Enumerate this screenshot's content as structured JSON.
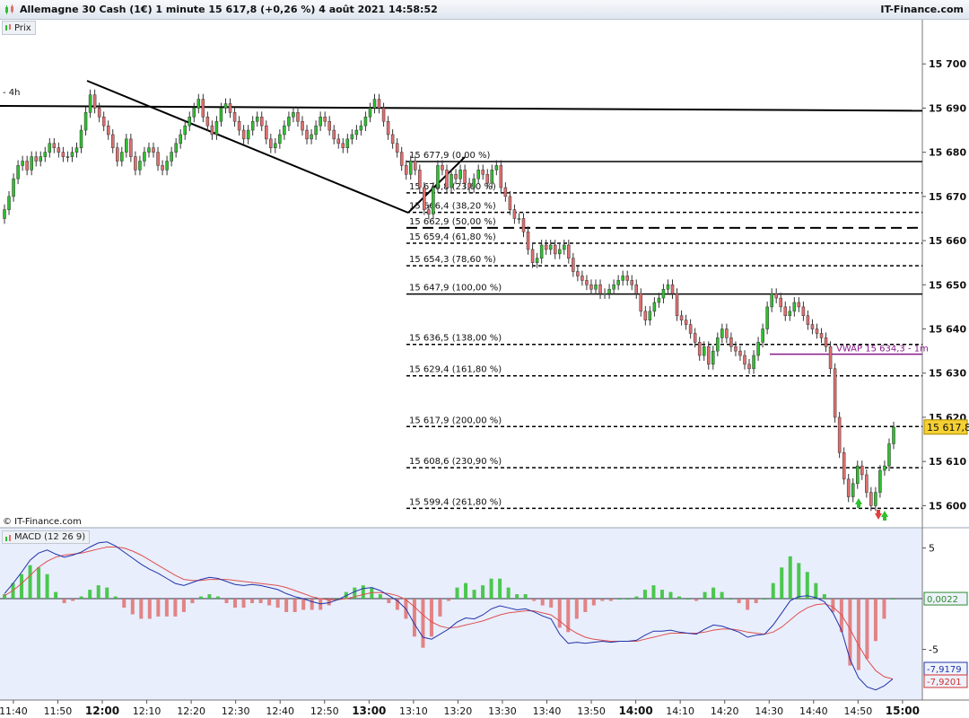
{
  "header": {
    "title": "Allemagne 30 Cash (1€) 1 minute 15 617,8 (+0,26 %) 4 août 2021 14:58:52",
    "brand": "IT-Finance.com"
  },
  "panels": {
    "price_tab": "Prix",
    "macd_tab": "MACD (12 26 9)",
    "copyright": "© IT-Finance.com",
    "timeframe_label": "- 4h"
  },
  "colors": {
    "up": "#2fbf2f",
    "down": "#e07070",
    "macd_line": "#2233aa",
    "signal_line": "#e05050",
    "vwap": "#8a1a8a",
    "price_badge": "#f5d033",
    "macd_bg": "#e8eefc"
  },
  "chart_data": [
    {
      "type": "candlestick",
      "title": "Allemagne 30 Cash (1€) 1 minute",
      "x_ticks": [
        "11:40",
        "11:50",
        "12:00",
        "12:10",
        "12:20",
        "12:30",
        "12:40",
        "12:50",
        "13:00",
        "13:10",
        "13:20",
        "13:30",
        "13:40",
        "13:50",
        "14:00",
        "14:10",
        "14:20",
        "14:30",
        "14:40",
        "14:50",
        "15:00"
      ],
      "bold_ticks": [
        "12:00",
        "13:00",
        "14:00",
        "15:00"
      ],
      "y_ticks": [
        "15 600",
        "15 610",
        "15 620",
        "15 630",
        "15 640",
        "15 650",
        "15 660",
        "15 670",
        "15 680",
        "15 690",
        "15 700"
      ],
      "ylim": [
        15595,
        15710
      ],
      "last_price": "15 617,8",
      "last_value": 15617.8,
      "fibonacci_levels": [
        {
          "label": "15 677,9 (0,00 %)",
          "value": 15677.9,
          "style": "solid"
        },
        {
          "label": "15 670,8 (23,60 %)",
          "value": 15670.8,
          "style": "dotted"
        },
        {
          "label": "15 666,4 (38,20 %)",
          "value": 15666.4,
          "style": "dotted"
        },
        {
          "label": "15 662,9 (50,00 %)",
          "value": 15662.9,
          "style": "dashed"
        },
        {
          "label": "15 659,4 (61,80 %)",
          "value": 15659.4,
          "style": "dotted"
        },
        {
          "label": "15 654,3 (78,60 %)",
          "value": 15654.3,
          "style": "dotted"
        },
        {
          "label": "15 647,9 (100,00 %)",
          "value": 15647.9,
          "style": "solid"
        },
        {
          "label": "15 636,5 (138,00 %)",
          "value": 15636.5,
          "style": "dotted"
        },
        {
          "label": "15 629,4 (161,80 %)",
          "value": 15629.4,
          "style": "dotted"
        },
        {
          "label": "15 617,9 (200,00 %)",
          "value": 15617.9,
          "style": "dotted"
        },
        {
          "label": "15 608,6 (230,90 %)",
          "value": 15608.6,
          "style": "dotted"
        },
        {
          "label": "15 599,4 (261,80 %)",
          "value": 15599.4,
          "style": "dotted"
        }
      ],
      "vwap": {
        "label": "VWAP 15 634,3 - 1m",
        "value": 15634.3
      },
      "close_prices": [
        15667,
        15670,
        15674,
        15677,
        15678,
        15676,
        15679,
        15678,
        15679,
        15680,
        15682,
        15681,
        15680,
        15679,
        15679,
        15680,
        15681,
        15685,
        15689,
        15693,
        15690,
        15688,
        15686,
        15684,
        15681,
        15678,
        15680,
        15683,
        15679,
        15676,
        15678,
        15680,
        15681,
        15680,
        15677,
        15676,
        15678,
        15680,
        15682,
        15684,
        15686,
        15688,
        15690,
        15692,
        15688,
        15686,
        15684,
        15687,
        15690,
        15691,
        15689,
        15687,
        15685,
        15683,
        15685,
        15687,
        15688,
        15686,
        15683,
        15681,
        15682,
        15684,
        15686,
        15688,
        15689,
        15687,
        15685,
        15683,
        15684,
        15686,
        15688,
        15687,
        15685,
        15683,
        15682,
        15681,
        15683,
        15684,
        15685,
        15686,
        15688,
        15690,
        15692,
        15690,
        15687,
        15684,
        15682,
        15680,
        15677,
        15675,
        15678,
        15676,
        15672,
        15667,
        15666,
        15672,
        15677,
        15676,
        15672,
        15675,
        15674,
        15676,
        15673,
        15672,
        15674,
        15676,
        15675,
        15673,
        15676,
        15677,
        15672,
        15670,
        15667,
        15665,
        15665,
        15662,
        15658,
        15655,
        15656,
        15659,
        15658,
        15659,
        15657,
        15658,
        15659,
        15656,
        15653,
        15652,
        15651,
        15650,
        15649,
        15650,
        15648,
        15648,
        15649,
        15650,
        15651,
        15652,
        15651,
        15650,
        15648,
        15644,
        15642,
        15644,
        15646,
        15647,
        15649,
        15650,
        15648,
        15643,
        15642,
        15641,
        15639,
        15637,
        15634,
        15636,
        15632,
        15635,
        15638,
        15640,
        15638,
        15636,
        15635,
        15634,
        15632,
        15631,
        15634,
        15637,
        15640,
        15645,
        15648,
        15647,
        15645,
        15643,
        15644,
        15646,
        15645,
        15643,
        15641,
        15640,
        15639,
        15638,
        15636,
        15631,
        15620,
        15612,
        15606,
        15602,
        15605,
        15609,
        15607,
        15603,
        15600,
        15603,
        15608,
        15609,
        15614,
        15617.8
      ],
      "open_prices": [
        15665,
        15667,
        15670,
        15674,
        15677,
        15678,
        15676,
        15679,
        15678,
        15679,
        15680,
        15682,
        15681,
        15680,
        15679,
        15679,
        15680,
        15681,
        15685,
        15689,
        15693,
        15690,
        15688,
        15686,
        15684,
        15681,
        15678,
        15680,
        15683,
        15679,
        15676,
        15678,
        15680,
        15681,
        15680,
        15677,
        15676,
        15678,
        15680,
        15682,
        15684,
        15686,
        15688,
        15690,
        15692,
        15688,
        15686,
        15684,
        15687,
        15690,
        15691,
        15689,
        15687,
        15685,
        15683,
        15685,
        15687,
        15688,
        15686,
        15683,
        15681,
        15682,
        15684,
        15686,
        15688,
        15689,
        15687,
        15685,
        15683,
        15684,
        15686,
        15688,
        15687,
        15685,
        15683,
        15682,
        15681,
        15683,
        15684,
        15685,
        15686,
        15688,
        15690,
        15692,
        15690,
        15687,
        15684,
        15682,
        15680,
        15677,
        15675,
        15678,
        15676,
        15672,
        15667,
        15666,
        15672,
        15677,
        15676,
        15672,
        15675,
        15674,
        15676,
        15673,
        15672,
        15674,
        15676,
        15675,
        15673,
        15676,
        15677,
        15672,
        15670,
        15667,
        15665,
        15665,
        15662,
        15658,
        15655,
        15656,
        15659,
        15658,
        15659,
        15657,
        15658,
        15659,
        15656,
        15653,
        15652,
        15651,
        15650,
        15649,
        15650,
        15648,
        15648,
        15649,
        15650,
        15651,
        15652,
        15651,
        15650,
        15648,
        15644,
        15642,
        15644,
        15646,
        15647,
        15649,
        15650,
        15648,
        15643,
        15642,
        15641,
        15639,
        15637,
        15634,
        15636,
        15632,
        15635,
        15638,
        15640,
        15638,
        15636,
        15635,
        15634,
        15632,
        15631,
        15634,
        15637,
        15640,
        15645,
        15648,
        15647,
        15645,
        15643,
        15644,
        15646,
        15645,
        15643,
        15641,
        15640,
        15639,
        15638,
        15636,
        15631,
        15620,
        15612,
        15606,
        15602,
        15605,
        15609,
        15607,
        15603,
        15600,
        15603,
        15608,
        15609,
        15614
      ]
    },
    {
      "type": "macd",
      "title": "MACD (12 26 9)",
      "y_ticks": [
        "5",
        "-5"
      ],
      "ylim": [
        -10,
        7
      ],
      "macd_value": "-7,9179",
      "signal_value": "-7,9201",
      "histogram_value": "0,0022",
      "macd_line": [
        0.5,
        1.5,
        2.6,
        3.8,
        4.5,
        4.8,
        4.4,
        4.1,
        4.3,
        4.6,
        5.1,
        5.5,
        5.6,
        5.2,
        4.6,
        4.0,
        3.4,
        2.9,
        2.5,
        2.0,
        1.5,
        1.3,
        1.6,
        1.9,
        2.1,
        2.0,
        1.7,
        1.4,
        1.3,
        1.4,
        1.3,
        1.1,
        0.9,
        0.5,
        0.2,
        0.0,
        -0.3,
        -0.5,
        -0.4,
        -0.1,
        0.3,
        0.7,
        1.0,
        1.1,
        0.8,
        0.3,
        -0.2,
        -1.0,
        -2.5,
        -3.8,
        -4.0,
        -3.5,
        -3.0,
        -2.3,
        -1.9,
        -2.0,
        -1.6,
        -1.0,
        -0.7,
        -0.9,
        -1.1,
        -1.0,
        -1.3,
        -1.7,
        -2.0,
        -3.5,
        -4.4,
        -4.3,
        -4.4,
        -4.3,
        -4.2,
        -4.3,
        -4.2,
        -4.2,
        -4.1,
        -3.6,
        -3.2,
        -3.2,
        -3.1,
        -3.3,
        -3.4,
        -3.5,
        -3.0,
        -2.6,
        -2.7,
        -3.0,
        -3.3,
        -3.8,
        -3.6,
        -3.5,
        -2.6,
        -1.4,
        -0.2,
        0.2,
        0.3,
        0.1,
        -0.3,
        -1.4,
        -3.1,
        -6.0,
        -7.8,
        -8.7,
        -9.0,
        -8.6,
        -7.9179
      ],
      "signal_line": [
        0.3,
        0.8,
        1.5,
        2.3,
        3.1,
        3.7,
        4.1,
        4.3,
        4.4,
        4.5,
        4.7,
        4.9,
        5.1,
        5.1,
        5.0,
        4.7,
        4.3,
        3.8,
        3.3,
        2.8,
        2.3,
        1.9,
        1.8,
        1.8,
        1.9,
        1.9,
        1.9,
        1.8,
        1.7,
        1.6,
        1.5,
        1.4,
        1.3,
        1.1,
        0.8,
        0.5,
        0.2,
        0.0,
        -0.1,
        -0.1,
        0.0,
        0.2,
        0.4,
        0.6,
        0.6,
        0.5,
        0.3,
        -0.1,
        -0.8,
        -1.6,
        -2.3,
        -2.7,
        -2.9,
        -2.8,
        -2.6,
        -2.4,
        -2.2,
        -1.9,
        -1.6,
        -1.4,
        -1.3,
        -1.2,
        -1.2,
        -1.4,
        -1.6,
        -2.2,
        -2.9,
        -3.4,
        -3.8,
        -4.0,
        -4.1,
        -4.2,
        -4.2,
        -4.2,
        -4.2,
        -4.0,
        -3.8,
        -3.6,
        -3.4,
        -3.4,
        -3.4,
        -3.4,
        -3.3,
        -3.1,
        -3.0,
        -3.0,
        -3.1,
        -3.3,
        -3.4,
        -3.5,
        -3.3,
        -2.8,
        -2.1,
        -1.4,
        -0.9,
        -0.6,
        -0.5,
        -0.8,
        -1.6,
        -3.0,
        -4.6,
        -6.0,
        -7.1,
        -7.7,
        -7.9201
      ]
    }
  ]
}
